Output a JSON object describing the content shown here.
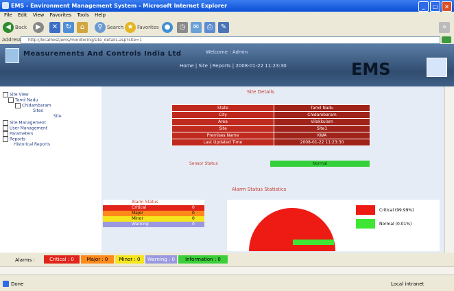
{
  "window": {
    "title": "EMS - Environment Management System - Microsoft Internet Explorer"
  },
  "menu": [
    "File",
    "Edit",
    "View",
    "Favorites",
    "Tools",
    "Help"
  ],
  "toolbar": {
    "back_label": "Back",
    "search_label": "Search",
    "favorites_label": "Favorites"
  },
  "address": {
    "label": "Address",
    "url": "http://localhost/ems/monitoring/site_details.asp?site=1"
  },
  "banner": {
    "brand": "Measurements And Controls India Ltd",
    "welcome": "Welcome : Admin",
    "sub": "Home   |   Site   |   Reports   |   2008-01-22   11:23:30",
    "logo_text": "EMS"
  },
  "sidebar": {
    "items": [
      {
        "label": "Site View"
      },
      {
        "label": "Tamil Nadu"
      },
      {
        "label": "Chidambaram"
      },
      {
        "label": "Sites"
      },
      {
        "label": "Site"
      },
      {
        "label": "Site Management"
      },
      {
        "label": "User Management"
      },
      {
        "label": "Parameters"
      },
      {
        "label": "Reports"
      },
      {
        "label": "Historical Reports"
      }
    ]
  },
  "site": {
    "title": "Site Details",
    "rows": [
      {
        "k": "State",
        "v": "Tamil Nadu"
      },
      {
        "k": "City",
        "v": "Chidambaram"
      },
      {
        "k": "Area",
        "v": "Vilakkulam"
      },
      {
        "k": "Site",
        "v": "Site1"
      },
      {
        "k": "Premises Name",
        "v": "KWA"
      },
      {
        "k": "Last Updated Time",
        "v": "2008-01-22 11:23:30"
      }
    ],
    "sensor_label": "Sensor Status",
    "sensor_value": "Normal"
  },
  "stats": {
    "title": "Alarm Status Statistics",
    "alarm_header": "Alarm Status",
    "alarms": [
      {
        "label": "Critical",
        "count": "0",
        "color": "#e0241a"
      },
      {
        "label": "Major",
        "count": "0",
        "color": "#ff8a1a"
      },
      {
        "label": "Minor",
        "count": "0",
        "color": "#f5e51c"
      },
      {
        "label": "Warning",
        "count": "0",
        "color": "#9a98e0"
      }
    ],
    "legend": [
      {
        "label": "Critical (99.99%)",
        "color": "#ee1b14"
      },
      {
        "label": "Normal (0.01%)",
        "color": "#3fe633"
      }
    ]
  },
  "alerts": {
    "label": "Alarms :",
    "chips": [
      {
        "label": "Critical : 0",
        "color": "#e0241a",
        "text": "#ffffff"
      },
      {
        "label": "Major : 0",
        "color": "#ff8a1a",
        "text": "#000000"
      },
      {
        "label": "Minor : 0",
        "color": "#f5e51c",
        "text": "#000000"
      },
      {
        "label": "Warning : 0",
        "color": "#9a98e0",
        "text": "#ffffff"
      },
      {
        "label": "Information : 0",
        "color": "#3ccf3a",
        "text": "#000000"
      }
    ]
  },
  "status": {
    "left": "Done",
    "zone": "Local intranet"
  }
}
